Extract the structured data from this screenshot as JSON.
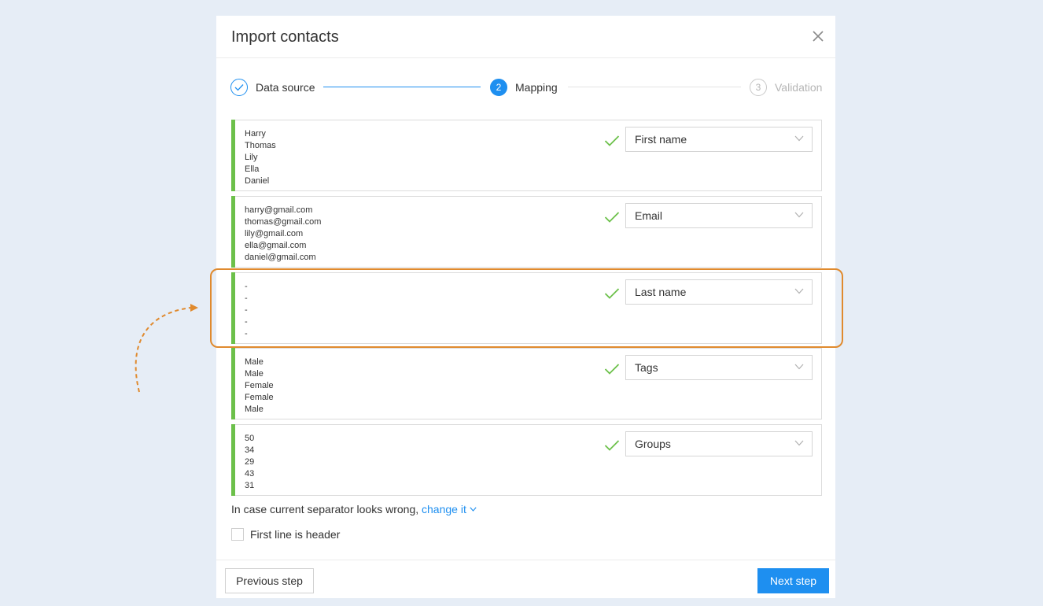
{
  "dialog": {
    "title": "Import contacts"
  },
  "steps": [
    {
      "label": "Data source",
      "state": "done"
    },
    {
      "label": "Mapping",
      "number": "2",
      "state": "active"
    },
    {
      "label": "Validation",
      "number": "3",
      "state": "todo"
    }
  ],
  "rows": [
    {
      "samples": [
        "Harry",
        "Thomas",
        "Lily",
        "Ella",
        "Daniel"
      ],
      "field": "First name"
    },
    {
      "samples": [
        "harry@gmail.com",
        "thomas@gmail.com",
        "lily@gmail.com",
        "ella@gmail.com",
        "daniel@gmail.com"
      ],
      "field": "Email"
    },
    {
      "samples": [
        "-",
        "-",
        "-",
        "-",
        "-"
      ],
      "field": "Last name"
    },
    {
      "samples": [
        "Male",
        "Male",
        "Female",
        "Female",
        "Male"
      ],
      "field": "Tags"
    },
    {
      "samples": [
        "50",
        "34",
        "29",
        "43",
        "31"
      ],
      "field": "Groups"
    }
  ],
  "separator": {
    "text": "In case current separator looks wrong,",
    "link": "change it"
  },
  "header_option": {
    "label": "First line is header",
    "checked": false
  },
  "footer": {
    "previous_label": "Previous step",
    "next_label": "Next step"
  },
  "colors": {
    "accent": "#1e8ff0",
    "mapped_bar": "#6cc04a",
    "annotation": "#e08a2e",
    "background": "#e6edf6"
  },
  "icons": {
    "close": "close-icon",
    "done": "checkmark-icon",
    "mapped": "checkmark-icon",
    "dropdown": "chevron-down-icon"
  }
}
